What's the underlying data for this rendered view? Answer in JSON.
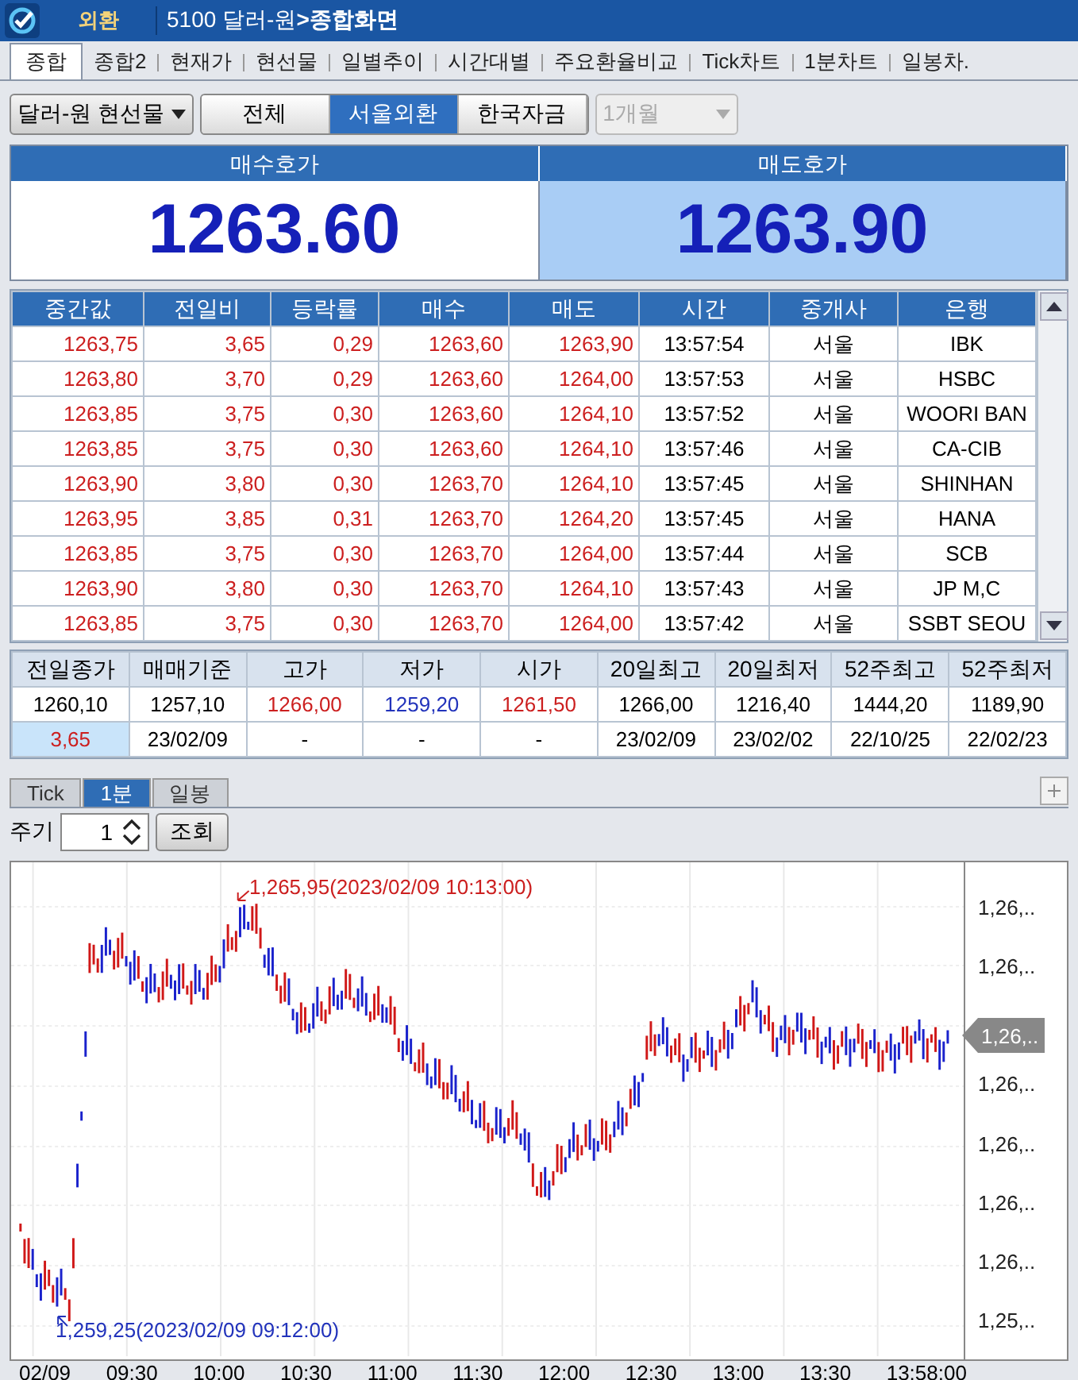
{
  "title_bar": {
    "badge": "외환",
    "title_code": "5100 달러-원",
    "title_arrow": ">",
    "title_screen": "종합화면"
  },
  "tabs": [
    {
      "label": "종합",
      "selected": true
    },
    {
      "label": "종합2",
      "selected": false
    },
    {
      "label": "현재가",
      "selected": false
    },
    {
      "label": "현선물",
      "selected": false
    },
    {
      "label": "일별추이",
      "selected": false
    },
    {
      "label": "시간대별",
      "selected": false
    },
    {
      "label": "주요환율비교",
      "selected": false
    },
    {
      "label": "Tick차트",
      "selected": false
    },
    {
      "label": "1분차트",
      "selected": false
    },
    {
      "label": "일봉차.",
      "selected": false
    }
  ],
  "toolbar": {
    "instrument": "달러-원 현선물",
    "segments": [
      {
        "label": "전체",
        "selected": false
      },
      {
        "label": "서울외환",
        "selected": true
      },
      {
        "label": "한국자금",
        "selected": false
      }
    ],
    "period": {
      "value": "1개월",
      "disabled": true
    }
  },
  "quotes": [
    {
      "label": "매수호가",
      "price": "1263.60",
      "highlighted": false
    },
    {
      "label": "매도호가",
      "price": "1263.90",
      "highlighted": true
    }
  ],
  "trades": {
    "columns": [
      "중간값",
      "전일비",
      "등락률",
      "매수",
      "매도",
      "시간",
      "중개사",
      "은행"
    ],
    "rows": [
      [
        "1263,75",
        "3,65",
        "0,29",
        "1263,60",
        "1263,90",
        "13:57:54",
        "서울",
        "IBK"
      ],
      [
        "1263,80",
        "3,70",
        "0,29",
        "1263,60",
        "1264,00",
        "13:57:53",
        "서울",
        "HSBC"
      ],
      [
        "1263,85",
        "3,75",
        "0,30",
        "1263,60",
        "1264,10",
        "13:57:52",
        "서울",
        "WOORI BAN"
      ],
      [
        "1263,85",
        "3,75",
        "0,30",
        "1263,60",
        "1264,10",
        "13:57:46",
        "서울",
        "CA-CIB"
      ],
      [
        "1263,90",
        "3,80",
        "0,30",
        "1263,70",
        "1264,10",
        "13:57:45",
        "서울",
        "SHINHAN"
      ],
      [
        "1263,95",
        "3,85",
        "0,31",
        "1263,70",
        "1264,20",
        "13:57:45",
        "서울",
        "HANA"
      ],
      [
        "1263,85",
        "3,75",
        "0,30",
        "1263,70",
        "1264,00",
        "13:57:44",
        "서울",
        "SCB"
      ],
      [
        "1263,90",
        "3,80",
        "0,30",
        "1263,70",
        "1264,10",
        "13:57:43",
        "서울",
        "JP M,C"
      ],
      [
        "1263,85",
        "3,75",
        "0,30",
        "1263,70",
        "1264,00",
        "13:57:42",
        "서울",
        "SSBT SEOU"
      ]
    ]
  },
  "summary": [
    {
      "header": "전일종가",
      "value": {
        "text": "1260,10",
        "color": "#000000"
      },
      "sub": {
        "text": "3,65",
        "color": "#cc1f1f",
        "highlighted": true
      }
    },
    {
      "header": "매매기준",
      "value": {
        "text": "1257,10",
        "color": "#000000"
      },
      "sub": {
        "text": "23/02/09",
        "color": "#000000",
        "highlighted": false
      }
    },
    {
      "header": "고가",
      "value": {
        "text": "1266,00",
        "color": "#cc1f1f"
      },
      "sub": {
        "text": "-",
        "color": "#000000",
        "highlighted": false
      }
    },
    {
      "header": "저가",
      "value": {
        "text": "1259,20",
        "color": "#2233bb"
      },
      "sub": {
        "text": "-",
        "color": "#000000",
        "highlighted": false
      }
    },
    {
      "header": "시가",
      "value": {
        "text": "1261,50",
        "color": "#cc1f1f"
      },
      "sub": {
        "text": "-",
        "color": "#000000",
        "highlighted": false
      }
    },
    {
      "header": "20일최고",
      "value": {
        "text": "1266,00",
        "color": "#000000"
      },
      "sub": {
        "text": "23/02/09",
        "color": "#000000",
        "highlighted": false
      }
    },
    {
      "header": "20일최저",
      "value": {
        "text": "1216,40",
        "color": "#000000"
      },
      "sub": {
        "text": "23/02/02",
        "color": "#000000",
        "highlighted": false
      }
    },
    {
      "header": "52주최고",
      "value": {
        "text": "1444,20",
        "color": "#000000"
      },
      "sub": {
        "text": "22/10/25",
        "color": "#000000",
        "highlighted": false
      }
    },
    {
      "header": "52주최저",
      "value": {
        "text": "1189,90",
        "color": "#000000"
      },
      "sub": {
        "text": "22/02/23",
        "color": "#000000",
        "highlighted": false
      }
    }
  ],
  "chart_tabs": [
    {
      "label": "Tick",
      "selected": false
    },
    {
      "label": "1분",
      "selected": true
    },
    {
      "label": "일봉",
      "selected": false
    }
  ],
  "chart_controls": {
    "period_label": "주기",
    "period_value": "1",
    "query_button": "조회"
  },
  "chart": {
    "high_note": "1,265,95(2023/02/09 10:13:00)",
    "low_note": "1,259,25(2023/02/09 09:12:00)",
    "current_tag": "1,26,..",
    "y_labels": [
      "1,26,..",
      "1,26,..",
      "1,26,..",
      "1,26,..",
      "1,26,..",
      "1,26,..",
      "1,25,.."
    ],
    "x_labels": [
      "02/09",
      "09:30",
      "10:00",
      "10:30",
      "11:00",
      "11:30",
      "12:00",
      "12:30",
      "13:00",
      "13:30",
      "13:58:00"
    ]
  }
}
